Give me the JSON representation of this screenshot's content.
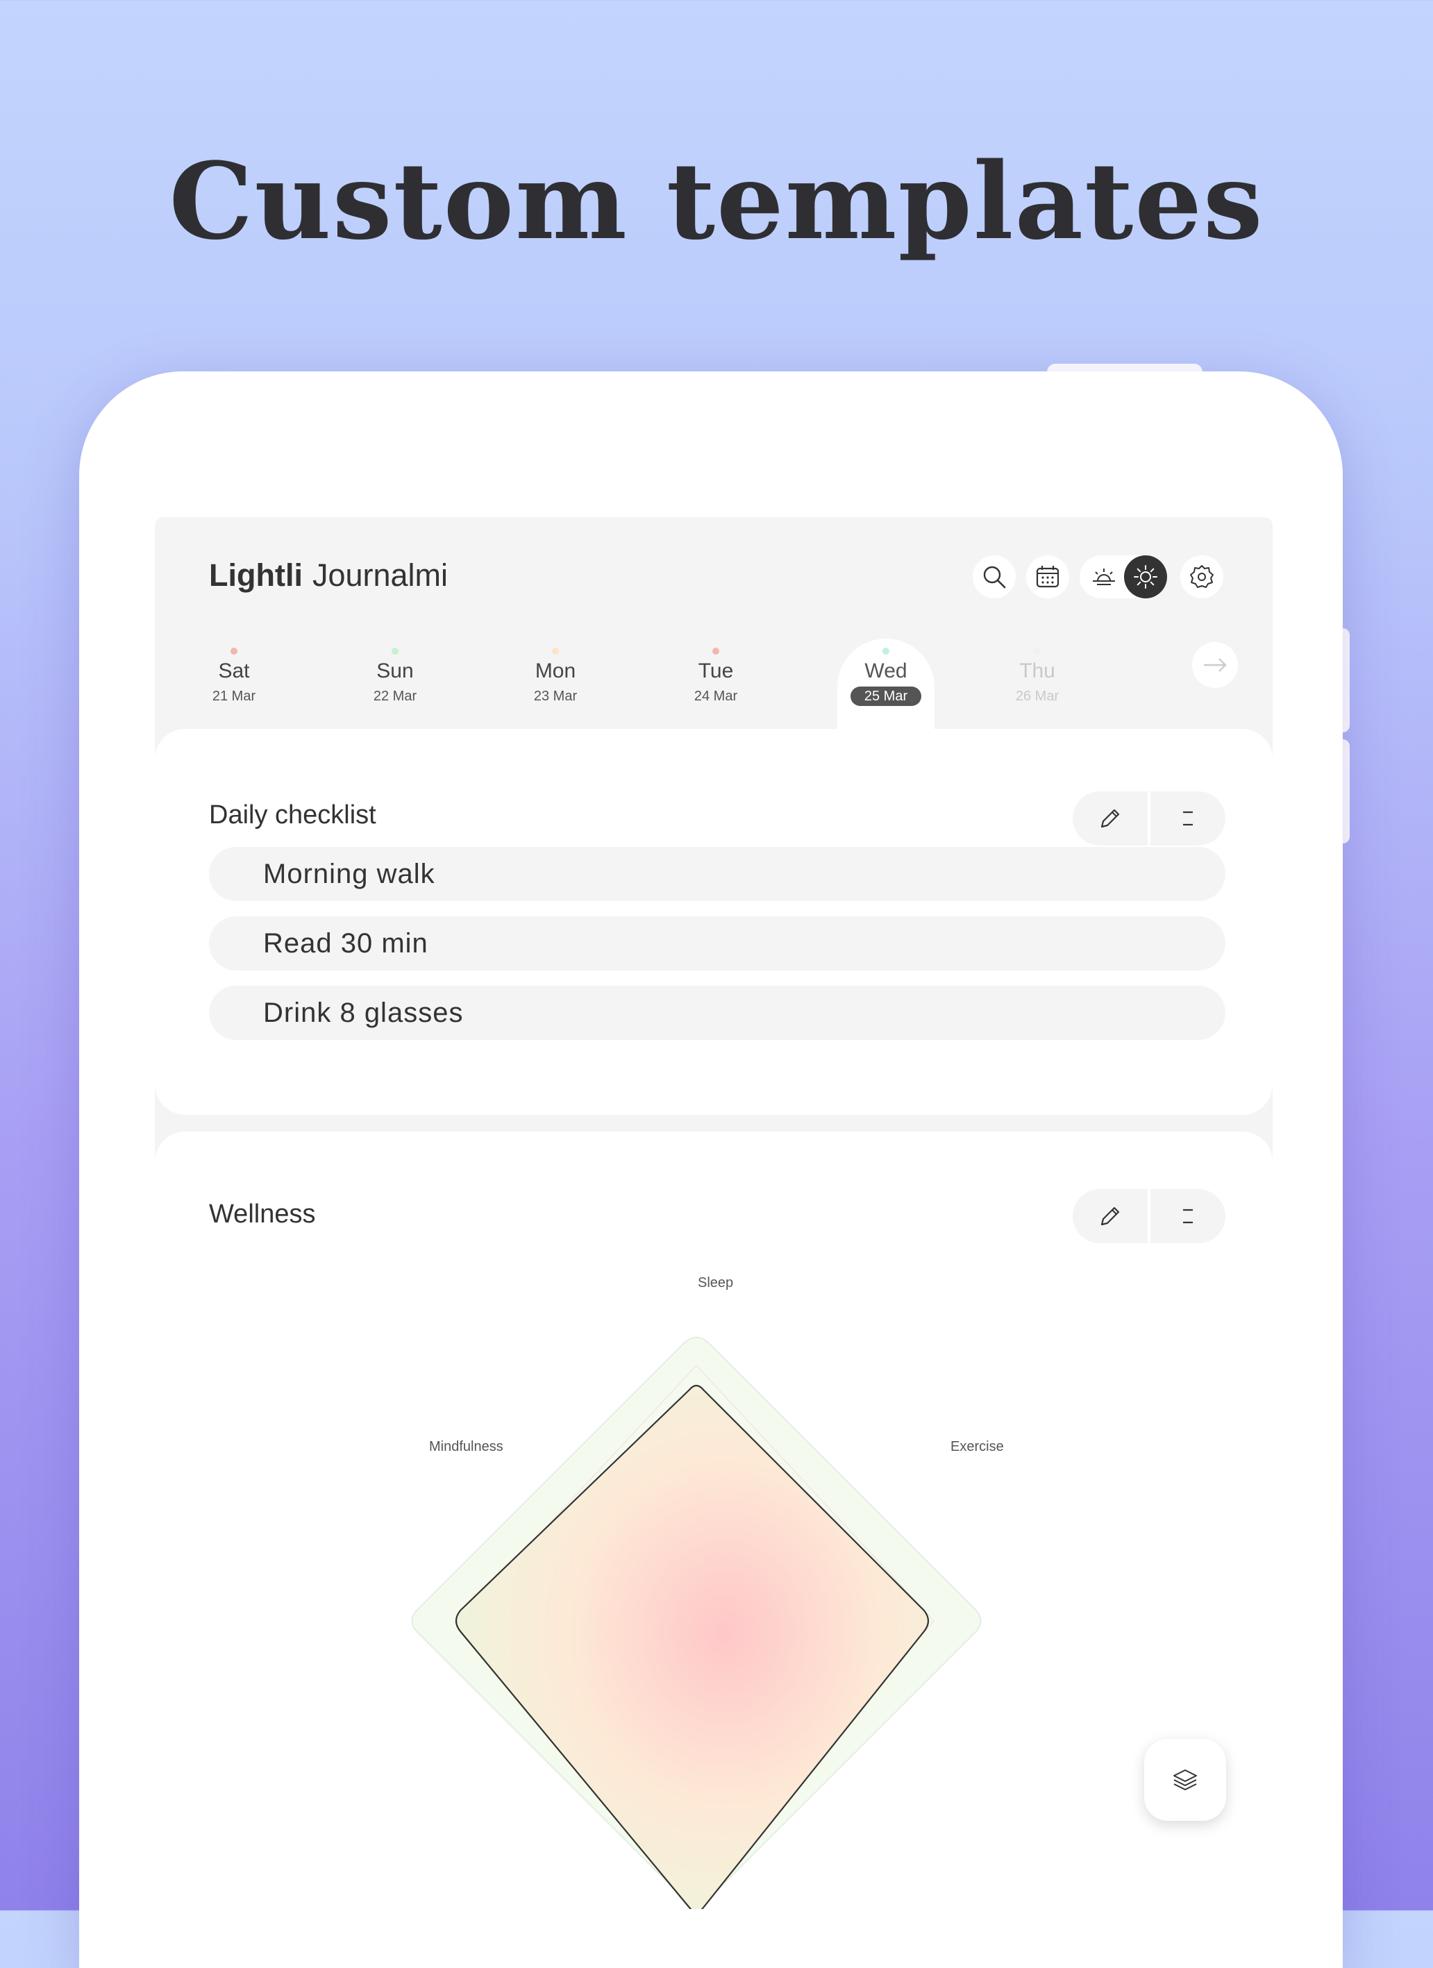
{
  "headline": "Custom templates",
  "app": {
    "brand_bold": "Lightli",
    "brand_light": "Journalmi"
  },
  "days": [
    {
      "name": "Sat",
      "date": "21 Mar",
      "dot": "#f5b5ad"
    },
    {
      "name": "Sun",
      "date": "22 Mar",
      "dot": "#c9f0cf"
    },
    {
      "name": "Mon",
      "date": "23 Mar",
      "dot": "#fde3c9"
    },
    {
      "name": "Tue",
      "date": "24 Mar",
      "dot": "#f5b5ad"
    },
    {
      "name": "Wed",
      "date": "25 Mar",
      "dot": "#bff0e6",
      "selected": true
    },
    {
      "name": "Thu",
      "date": "26 Mar",
      "dot": "#f0f0f0"
    }
  ],
  "checklist": {
    "title": "Daily checklist",
    "items": [
      "Morning walk",
      "Read 30 min",
      "Drink 8 glasses"
    ]
  },
  "wellness": {
    "title": "Wellness",
    "axes": [
      "Sleep",
      "Exercise",
      "Mindfulness"
    ]
  },
  "icons": {
    "search": "search-icon",
    "calendar": "calendar-icon",
    "sunrise": "sunrise-icon",
    "sun": "sun-icon",
    "settings": "gear-icon",
    "next": "arrow-right-icon",
    "edit": "pencil-icon",
    "menu": "menu-lines-icon",
    "layers": "layers-icon"
  },
  "colors": {
    "accent_dark": "#333333",
    "screen_bg": "#f4f4f4"
  }
}
